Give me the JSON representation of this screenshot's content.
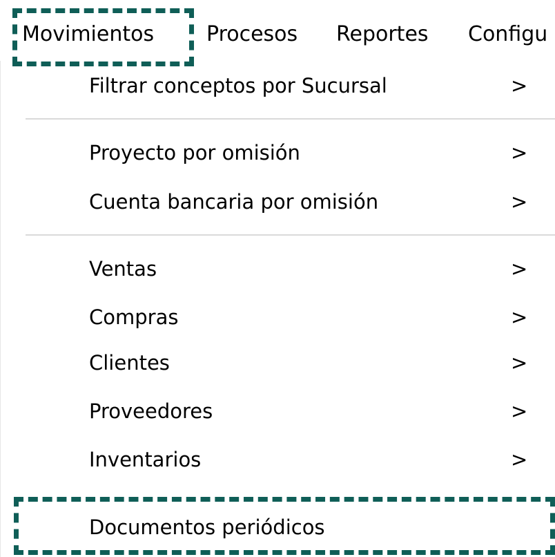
{
  "menubar": {
    "items": [
      {
        "label": "Movimientos"
      },
      {
        "label": "Procesos"
      },
      {
        "label": "Reportes"
      },
      {
        "label": "Configu"
      }
    ]
  },
  "dropdown": {
    "items": [
      {
        "label": "Filtrar conceptos por Sucursal",
        "submenu_arrow": ">"
      },
      {
        "label": "Proyecto por omisión",
        "submenu_arrow": ">"
      },
      {
        "label": "Cuenta bancaria por omisión",
        "submenu_arrow": ">"
      },
      {
        "label": "Ventas",
        "submenu_arrow": ">"
      },
      {
        "label": "Compras",
        "submenu_arrow": ">"
      },
      {
        "label": "Clientes",
        "submenu_arrow": ">"
      },
      {
        "label": "Proveedores",
        "submenu_arrow": ">"
      },
      {
        "label": "Inventarios",
        "submenu_arrow": ">"
      },
      {
        "label": "Documentos periódicos"
      }
    ]
  },
  "colors": {
    "highlight_border": "#0f5e57",
    "separator": "#d9d9d9",
    "text": "#000000",
    "background": "#ffffff"
  },
  "icons": {
    "submenu_arrow": "chevron-right-icon"
  }
}
